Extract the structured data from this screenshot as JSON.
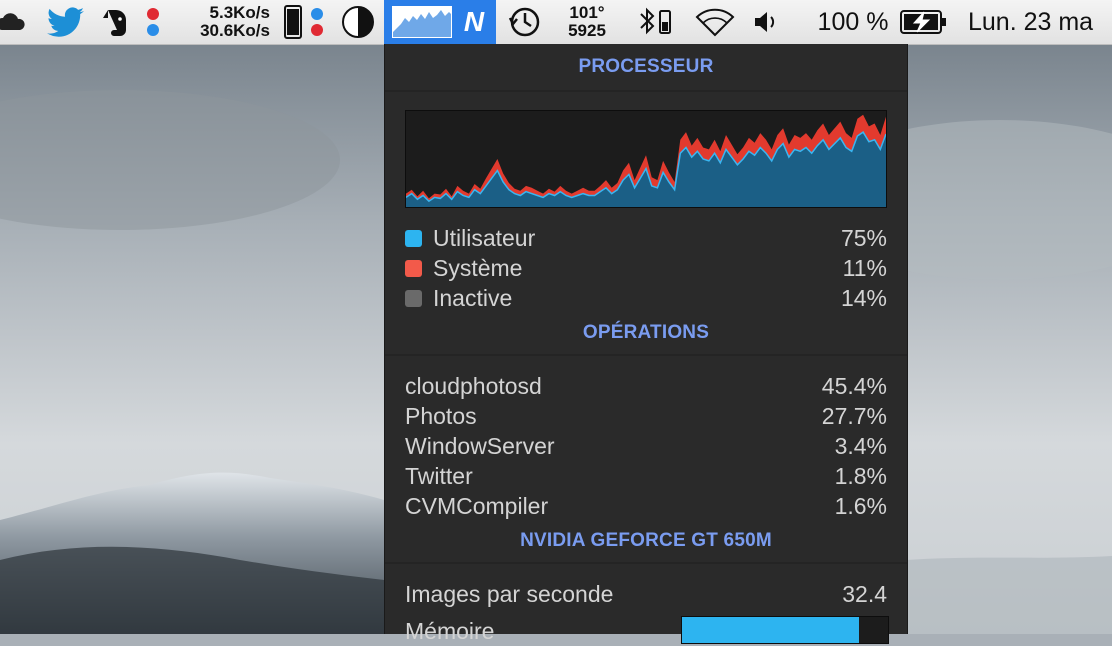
{
  "menubar": {
    "net_up": "5.3Ko/s",
    "net_down": "30.6Ko/s",
    "temperature": "101°",
    "fan_rpm": "5925",
    "active_item_label": "N",
    "battery_percent": "100 %",
    "clock": "Lun. 23 ma"
  },
  "panel": {
    "processor": {
      "title": "PROCESSEUR",
      "legend": [
        {
          "label": "Utilisateur",
          "value": "75%",
          "color": "#2db4f0"
        },
        {
          "label": "Système",
          "value": "11%",
          "color": "#f25a4a"
        },
        {
          "label": "Inactive",
          "value": "14%",
          "color": "#6a6a6a"
        }
      ],
      "graph_user": [
        10,
        14,
        8,
        12,
        6,
        10,
        9,
        14,
        8,
        16,
        12,
        10,
        18,
        14,
        22,
        30,
        38,
        26,
        18,
        14,
        12,
        16,
        14,
        12,
        10,
        14,
        12,
        16,
        12,
        10,
        12,
        14,
        12,
        12,
        16,
        20,
        14,
        18,
        28,
        34,
        20,
        30,
        40,
        22,
        20,
        36,
        26,
        18,
        56,
        62,
        52,
        58,
        50,
        48,
        56,
        46,
        60,
        52,
        44,
        50,
        58,
        54,
        62,
        56,
        48,
        60,
        66,
        52,
        60,
        58,
        62,
        56,
        64,
        70,
        60,
        66,
        72,
        62,
        58,
        74,
        78,
        68,
        70,
        60,
        76
      ],
      "graph_system": [
        4,
        4,
        3,
        5,
        3,
        4,
        4,
        5,
        3,
        6,
        5,
        4,
        6,
        5,
        8,
        10,
        12,
        9,
        7,
        5,
        5,
        6,
        6,
        5,
        4,
        5,
        4,
        6,
        5,
        4,
        5,
        6,
        5,
        5,
        6,
        8,
        6,
        7,
        10,
        12,
        8,
        11,
        14,
        9,
        8,
        12,
        10,
        8,
        14,
        16,
        12,
        14,
        12,
        12,
        14,
        12,
        15,
        13,
        11,
        12,
        14,
        13,
        15,
        14,
        12,
        15,
        16,
        13,
        15,
        14,
        15,
        14,
        16,
        17,
        15,
        16,
        17,
        15,
        14,
        18,
        18,
        16,
        17,
        15,
        18
      ]
    },
    "operations": {
      "title": "OPÉRATIONS",
      "items": [
        {
          "name": "cloudphotosd",
          "value": "45.4%"
        },
        {
          "name": "Photos",
          "value": "27.7%"
        },
        {
          "name": "WindowServer",
          "value": "3.4%"
        },
        {
          "name": "Twitter",
          "value": "1.8%"
        },
        {
          "name": "CVMCompiler",
          "value": "1.6%"
        }
      ]
    },
    "gpu": {
      "title": "NVIDIA GEFORCE GT 650M",
      "fps_label": "Images par seconde",
      "fps_value": "32.4",
      "memory_label": "Mémoire",
      "memory_fraction": 0.86,
      "memory_color": "#2db4f0"
    }
  }
}
